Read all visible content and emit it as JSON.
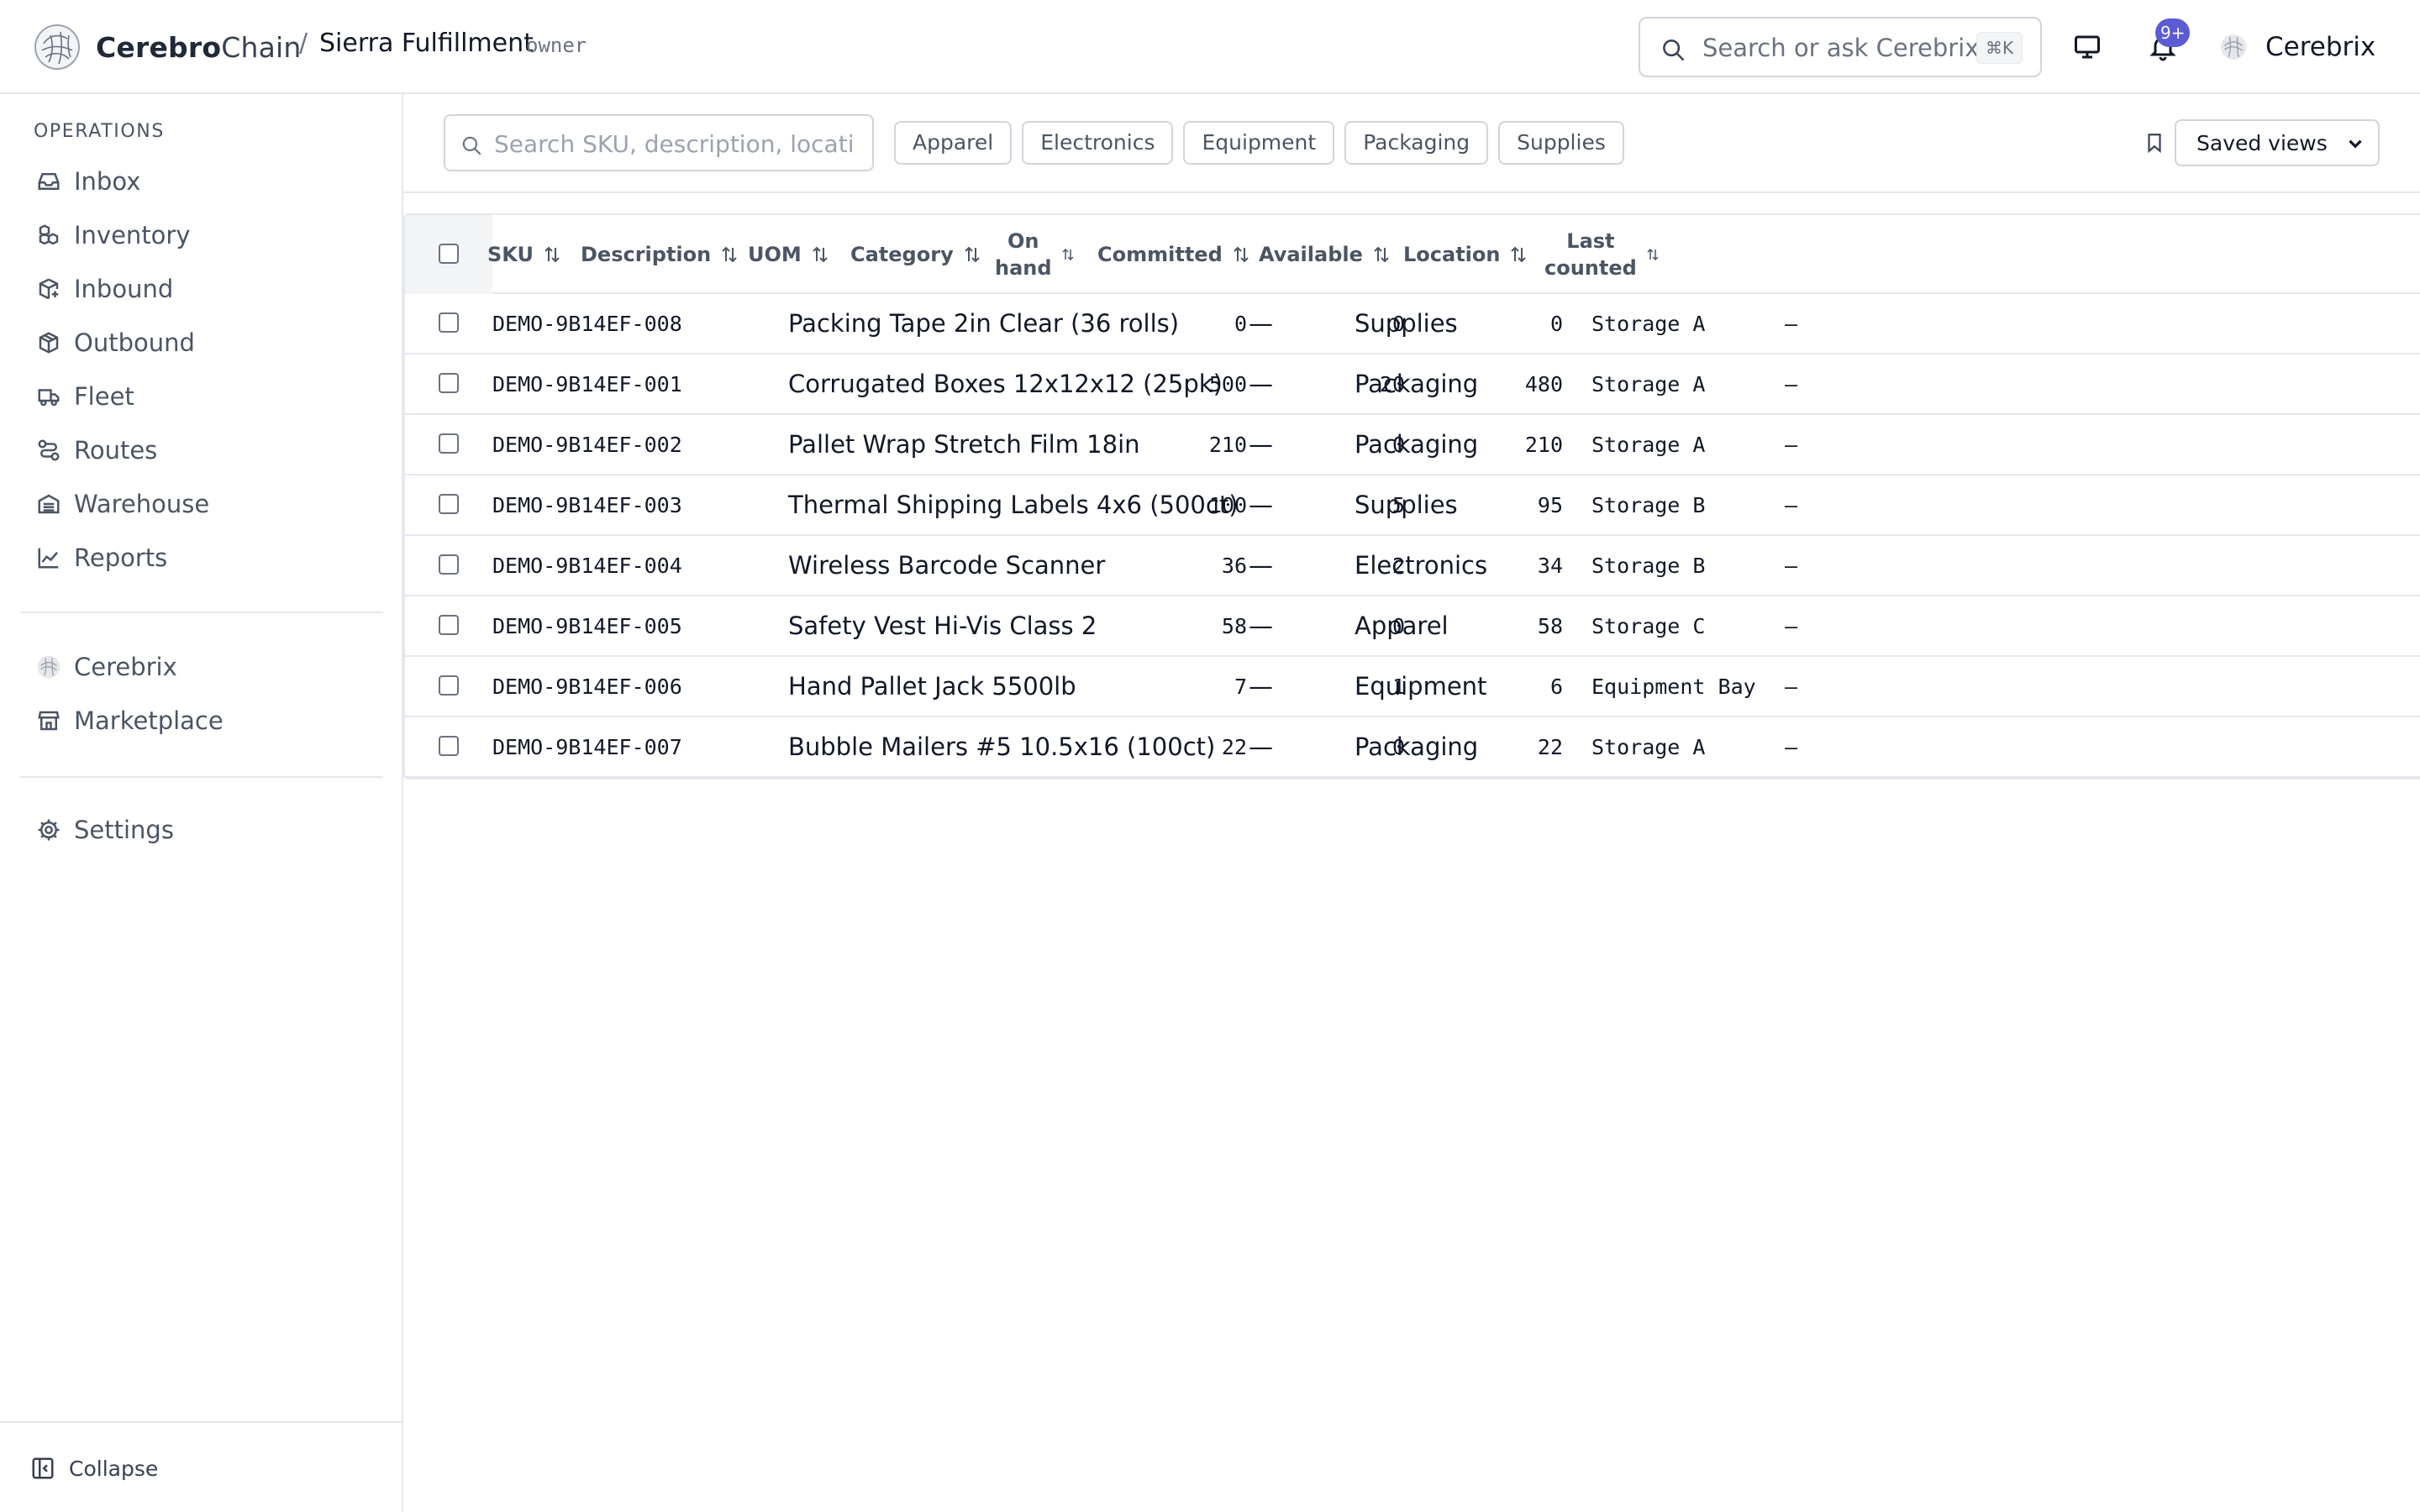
{
  "header": {
    "brand_bold": "Cerebro",
    "brand_light": "Chain",
    "separator": "/",
    "org": "Sierra Fulfillment",
    "role": "owner",
    "search_placeholder": "Search or ask Cerebrix",
    "search_shortcut": "⌘K",
    "notification_badge": "9+",
    "user_name": "Cerebrix"
  },
  "sidebar": {
    "section_label": "OPERATIONS",
    "items": [
      {
        "label": "Inbox",
        "icon": "inbox-icon"
      },
      {
        "label": "Inventory",
        "icon": "boxes-icon"
      },
      {
        "label": "Inbound",
        "icon": "package-in-icon"
      },
      {
        "label": "Outbound",
        "icon": "package-out-icon"
      },
      {
        "label": "Fleet",
        "icon": "truck-icon"
      },
      {
        "label": "Routes",
        "icon": "route-icon"
      },
      {
        "label": "Warehouse",
        "icon": "warehouse-icon"
      },
      {
        "label": "Reports",
        "icon": "line-chart-icon"
      }
    ],
    "secondary": [
      {
        "label": "Cerebrix",
        "icon": "cerebrix-orb-icon"
      },
      {
        "label": "Marketplace",
        "icon": "store-icon"
      }
    ],
    "settings_label": "Settings",
    "collapse_label": "Collapse"
  },
  "filters": {
    "search_placeholder": "Search SKU, description, location",
    "chips": [
      "Apparel",
      "Electronics",
      "Equipment",
      "Packaging",
      "Supplies"
    ],
    "saved_views_label": "Saved views"
  },
  "table": {
    "columns": {
      "sku": "SKU",
      "description": "Description",
      "uom": "UOM",
      "category": "Category",
      "on_hand_line1": "On",
      "on_hand_line2": "hand",
      "committed": "Committed",
      "available": "Available",
      "location": "Location",
      "last_counted_line1": "Last",
      "last_counted_line2": "counted"
    },
    "rows": [
      {
        "sku": "DEMO-9B14EF-008",
        "description": "Packing Tape 2in Clear (36 rolls)",
        "uom": "—",
        "category": "Supplies",
        "on_hand": "0",
        "committed": "0",
        "available": "0",
        "location": "Storage A",
        "last_counted": "–"
      },
      {
        "sku": "DEMO-9B14EF-001",
        "description": "Corrugated Boxes 12x12x12 (25pk)",
        "uom": "—",
        "category": "Packaging",
        "on_hand": "500",
        "committed": "20",
        "available": "480",
        "location": "Storage A",
        "last_counted": "–"
      },
      {
        "sku": "DEMO-9B14EF-002",
        "description": "Pallet Wrap Stretch Film 18in",
        "uom": "—",
        "category": "Packaging",
        "on_hand": "210",
        "committed": "0",
        "available": "210",
        "location": "Storage A",
        "last_counted": "–"
      },
      {
        "sku": "DEMO-9B14EF-003",
        "description": "Thermal Shipping Labels 4x6 (500ct)",
        "uom": "—",
        "category": "Supplies",
        "on_hand": "100",
        "committed": "5",
        "available": "95",
        "location": "Storage B",
        "last_counted": "–"
      },
      {
        "sku": "DEMO-9B14EF-004",
        "description": "Wireless Barcode Scanner",
        "uom": "—",
        "category": "Electronics",
        "on_hand": "36",
        "committed": "2",
        "available": "34",
        "location": "Storage B",
        "last_counted": "–"
      },
      {
        "sku": "DEMO-9B14EF-005",
        "description": "Safety Vest Hi-Vis Class 2",
        "uom": "—",
        "category": "Apparel",
        "on_hand": "58",
        "committed": "0",
        "available": "58",
        "location": "Storage C",
        "last_counted": "–"
      },
      {
        "sku": "DEMO-9B14EF-006",
        "description": "Hand Pallet Jack 5500lb",
        "uom": "—",
        "category": "Equipment",
        "on_hand": "7",
        "committed": "1",
        "available": "6",
        "location": "Equipment Bay",
        "last_counted": "–"
      },
      {
        "sku": "DEMO-9B14EF-007",
        "description": "Bubble Mailers #5 10.5x16 (100ct)",
        "uom": "—",
        "category": "Packaging",
        "on_hand": "22",
        "committed": "0",
        "available": "22",
        "location": "Storage A",
        "last_counted": "–"
      }
    ]
  },
  "colors": {
    "accent": "#5b5bd6",
    "border": "#e5e7eb",
    "muted_text": "#4b5563"
  }
}
